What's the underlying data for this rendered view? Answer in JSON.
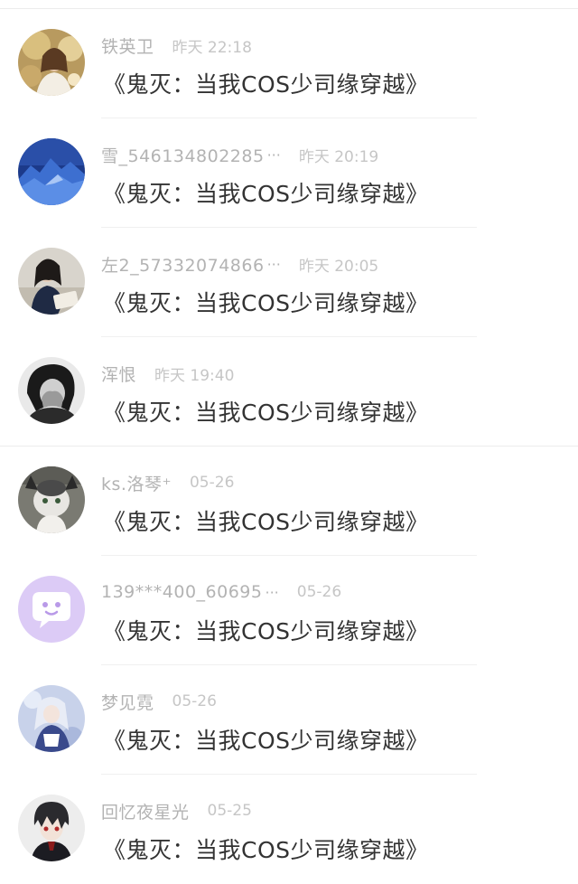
{
  "rows": [
    {
      "name": "铁英卫",
      "time": "昨天 22:18",
      "message": "《鬼灭：当我COS少司缘穿越》",
      "avatar": "woman-with-flowers-avatar"
    },
    {
      "name": "雪_546134802285",
      "time": "昨天 20:19",
      "message": "《鬼灭：当我COS少司缘穿越》",
      "avatar": "blue-mountain-avatar"
    },
    {
      "name": "左2_57332074866",
      "time": "昨天 20:05",
      "message": "《鬼灭：当我COS少司缘穿越》",
      "avatar": "girl-with-book-avatar"
    },
    {
      "name": "浑恨",
      "time": "昨天 19:40",
      "message": "《鬼灭：当我COS少司缘穿越》",
      "avatar": "crying-woman-avatar"
    },
    {
      "name": "ks.洛琴⁺",
      "time": "05-26",
      "message": "《鬼灭：当我COS少司缘穿越》",
      "avatar": "cat-avatar"
    },
    {
      "name": "139***400_60695",
      "time": "05-26",
      "message": "《鬼灭：当我COS少司缘穿越》",
      "avatar": "default-chat-avatar"
    },
    {
      "name": "梦见霓",
      "time": "05-26",
      "message": "《鬼灭：当我COS少司缘穿越》",
      "avatar": "anime-girl-avatar"
    },
    {
      "name": "回忆夜星光",
      "time": "05-25",
      "message": "《鬼灭：当我COS少司缘穿越》",
      "avatar": "anime-boy-avatar"
    }
  ],
  "ellipsis": "···",
  "colors": {
    "name": "#b3b3b3",
    "time": "#c6c6c6",
    "message": "#333333",
    "default_avatar_bg": "#d9c8f5"
  }
}
